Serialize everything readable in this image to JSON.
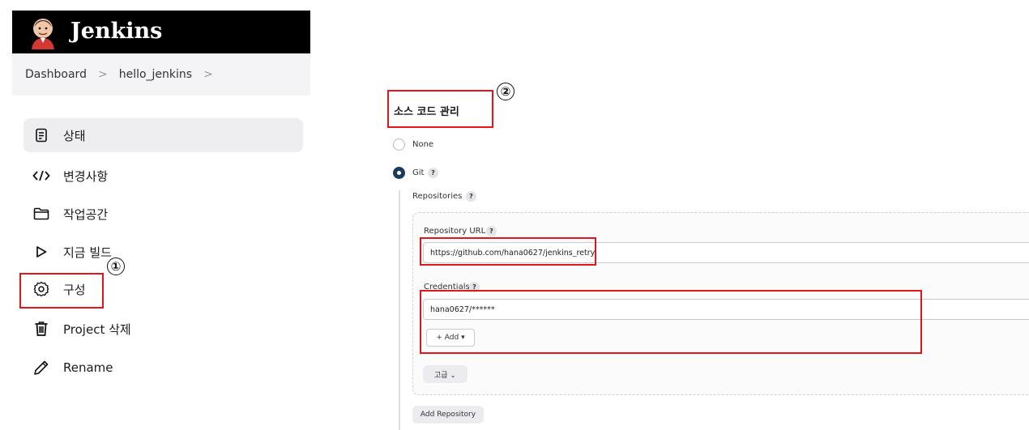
{
  "header": {
    "brand": "Jenkins",
    "logo": "jenkins-butler-logo"
  },
  "breadcrumb": {
    "items": [
      "Dashboard",
      "hello_jenkins"
    ],
    "separator": ">"
  },
  "sidebar": {
    "items": [
      {
        "label": "상태",
        "icon": "status-document-icon",
        "active": true
      },
      {
        "label": "변경사항",
        "icon": "code-icon"
      },
      {
        "label": "작업공간",
        "icon": "folder-icon"
      },
      {
        "label": "지금 빌드",
        "icon": "play-icon"
      },
      {
        "label": "구성",
        "icon": "gear-icon"
      },
      {
        "label": "Project 삭제",
        "icon": "trash-icon"
      },
      {
        "label": "Rename",
        "icon": "pencil-icon"
      }
    ]
  },
  "annotations": {
    "marker1": "①",
    "marker2": "②",
    "highlight_color": "#e2161a"
  },
  "scm": {
    "title": "소스 코드 관리",
    "option_none": "None",
    "option_git": "Git",
    "help": "?",
    "repositories_label": "Repositories",
    "repository_url_label": "Repository URL",
    "repository_url_value": "https://github.com/hana0627/jenkins_retry",
    "credentials_label": "Credentials",
    "credentials_value": "hana0627/******",
    "add_button": "+ Add ▾",
    "advanced_button": "고급 ⌄",
    "add_repository_button": "Add Repository"
  },
  "colors": {
    "topbar": "#000000",
    "accent_dark": "#1b3a5c",
    "breadcrumb_bg": "#f4f4f6"
  }
}
